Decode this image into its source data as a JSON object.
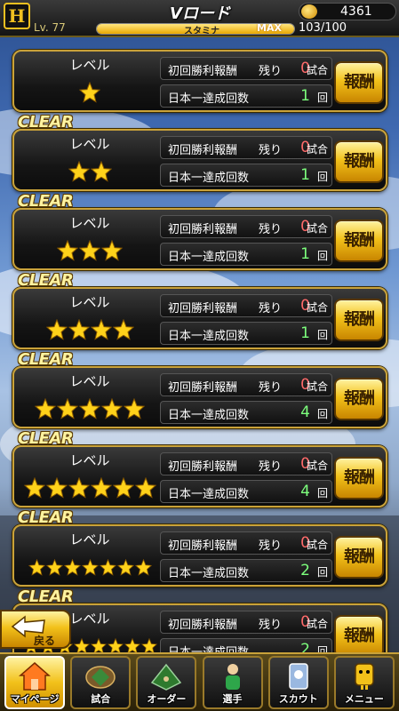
{
  "header": {
    "title": "Vロード",
    "level": "Lv. 77",
    "stamina_label": "スタミナ",
    "stamina_max_label": "MAX",
    "stamina_value": "103/100",
    "stamina_fill": 1.0,
    "coins": "4361",
    "logo_icon": "team-logo-icon"
  },
  "cards": [
    {
      "clear": "",
      "level_label": "レベル",
      "stars": 1,
      "reward_label": "初回勝利報酬",
      "remain_label": "残り",
      "remain_count": "0",
      "remain_unit": "試合",
      "title_label": "日本一達成回数",
      "title_count": "1",
      "title_unit": "回",
      "button": "報酬"
    },
    {
      "clear": "CLEAR",
      "level_label": "レベル",
      "stars": 2,
      "reward_label": "初回勝利報酬",
      "remain_label": "残り",
      "remain_count": "0",
      "remain_unit": "試合",
      "title_label": "日本一達成回数",
      "title_count": "1",
      "title_unit": "回",
      "button": "報酬"
    },
    {
      "clear": "CLEAR",
      "level_label": "レベル",
      "stars": 3,
      "reward_label": "初回勝利報酬",
      "remain_label": "残り",
      "remain_count": "0",
      "remain_unit": "試合",
      "title_label": "日本一達成回数",
      "title_count": "1",
      "title_unit": "回",
      "button": "報酬"
    },
    {
      "clear": "CLEAR",
      "level_label": "レベル",
      "stars": 4,
      "reward_label": "初回勝利報酬",
      "remain_label": "残り",
      "remain_count": "0",
      "remain_unit": "試合",
      "title_label": "日本一達成回数",
      "title_count": "1",
      "title_unit": "回",
      "button": "報酬"
    },
    {
      "clear": "CLEAR",
      "level_label": "レベル",
      "stars": 5,
      "reward_label": "初回勝利報酬",
      "remain_label": "残り",
      "remain_count": "0",
      "remain_unit": "試合",
      "title_label": "日本一達成回数",
      "title_count": "4",
      "title_unit": "回",
      "button": "報酬"
    },
    {
      "clear": "CLEAR",
      "level_label": "レベル",
      "stars": 6,
      "reward_label": "初回勝利報酬",
      "remain_label": "残り",
      "remain_count": "0",
      "remain_unit": "試合",
      "title_label": "日本一達成回数",
      "title_count": "4",
      "title_unit": "回",
      "button": "報酬"
    },
    {
      "clear": "CLEAR",
      "level_label": "レベル",
      "stars": 7,
      "reward_label": "初回勝利報酬",
      "remain_label": "残り",
      "remain_count": "0",
      "remain_unit": "試合",
      "title_label": "日本一達成回数",
      "title_count": "2",
      "title_unit": "回",
      "button": "報酬"
    },
    {
      "clear": "CLEAR",
      "level_label": "レベル",
      "stars": 8,
      "reward_label": "初回勝利報酬",
      "remain_label": "残り",
      "remain_count": "0",
      "remain_unit": "試合",
      "title_label": "日本一達成回数",
      "title_count": "2",
      "title_unit": "回",
      "button": "報酬"
    }
  ],
  "back": {
    "label": "戻る",
    "icon": "back-arrow-icon"
  },
  "nav": [
    {
      "label": "マイページ",
      "icon": "mypage-icon",
      "active": true
    },
    {
      "label": "試合",
      "icon": "stadium-icon",
      "active": false
    },
    {
      "label": "オーダー",
      "icon": "order-field-icon",
      "active": false
    },
    {
      "label": "選手",
      "icon": "player-icon",
      "active": false
    },
    {
      "label": "スカウト",
      "icon": "scout-card-icon",
      "active": false
    },
    {
      "label": "メニュー",
      "icon": "menu-mascot-icon",
      "active": false
    }
  ],
  "colors": {
    "accent_gold": "#f2c11a",
    "count_red": "#ff6a6a",
    "count_green": "#7dff7d"
  }
}
